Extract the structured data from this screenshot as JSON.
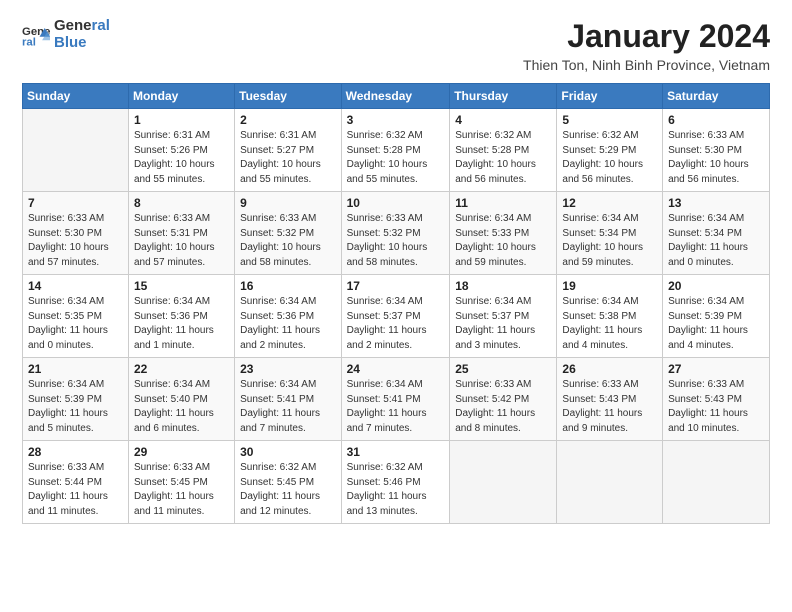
{
  "logo": {
    "text_general": "General",
    "text_blue": "Blue"
  },
  "title": "January 2024",
  "subtitle": "Thien Ton, Ninh Binh Province, Vietnam",
  "days_header": [
    "Sunday",
    "Monday",
    "Tuesday",
    "Wednesday",
    "Thursday",
    "Friday",
    "Saturday"
  ],
  "weeks": [
    [
      {
        "day": "",
        "info": ""
      },
      {
        "day": "1",
        "info": "Sunrise: 6:31 AM\nSunset: 5:26 PM\nDaylight: 10 hours\nand 55 minutes."
      },
      {
        "day": "2",
        "info": "Sunrise: 6:31 AM\nSunset: 5:27 PM\nDaylight: 10 hours\nand 55 minutes."
      },
      {
        "day": "3",
        "info": "Sunrise: 6:32 AM\nSunset: 5:28 PM\nDaylight: 10 hours\nand 55 minutes."
      },
      {
        "day": "4",
        "info": "Sunrise: 6:32 AM\nSunset: 5:28 PM\nDaylight: 10 hours\nand 56 minutes."
      },
      {
        "day": "5",
        "info": "Sunrise: 6:32 AM\nSunset: 5:29 PM\nDaylight: 10 hours\nand 56 minutes."
      },
      {
        "day": "6",
        "info": "Sunrise: 6:33 AM\nSunset: 5:30 PM\nDaylight: 10 hours\nand 56 minutes."
      }
    ],
    [
      {
        "day": "7",
        "info": "Sunrise: 6:33 AM\nSunset: 5:30 PM\nDaylight: 10 hours\nand 57 minutes."
      },
      {
        "day": "8",
        "info": "Sunrise: 6:33 AM\nSunset: 5:31 PM\nDaylight: 10 hours\nand 57 minutes."
      },
      {
        "day": "9",
        "info": "Sunrise: 6:33 AM\nSunset: 5:32 PM\nDaylight: 10 hours\nand 58 minutes."
      },
      {
        "day": "10",
        "info": "Sunrise: 6:33 AM\nSunset: 5:32 PM\nDaylight: 10 hours\nand 58 minutes."
      },
      {
        "day": "11",
        "info": "Sunrise: 6:34 AM\nSunset: 5:33 PM\nDaylight: 10 hours\nand 59 minutes."
      },
      {
        "day": "12",
        "info": "Sunrise: 6:34 AM\nSunset: 5:34 PM\nDaylight: 10 hours\nand 59 minutes."
      },
      {
        "day": "13",
        "info": "Sunrise: 6:34 AM\nSunset: 5:34 PM\nDaylight: 11 hours\nand 0 minutes."
      }
    ],
    [
      {
        "day": "14",
        "info": "Sunrise: 6:34 AM\nSunset: 5:35 PM\nDaylight: 11 hours\nand 0 minutes."
      },
      {
        "day": "15",
        "info": "Sunrise: 6:34 AM\nSunset: 5:36 PM\nDaylight: 11 hours\nand 1 minute."
      },
      {
        "day": "16",
        "info": "Sunrise: 6:34 AM\nSunset: 5:36 PM\nDaylight: 11 hours\nand 2 minutes."
      },
      {
        "day": "17",
        "info": "Sunrise: 6:34 AM\nSunset: 5:37 PM\nDaylight: 11 hours\nand 2 minutes."
      },
      {
        "day": "18",
        "info": "Sunrise: 6:34 AM\nSunset: 5:37 PM\nDaylight: 11 hours\nand 3 minutes."
      },
      {
        "day": "19",
        "info": "Sunrise: 6:34 AM\nSunset: 5:38 PM\nDaylight: 11 hours\nand 4 minutes."
      },
      {
        "day": "20",
        "info": "Sunrise: 6:34 AM\nSunset: 5:39 PM\nDaylight: 11 hours\nand 4 minutes."
      }
    ],
    [
      {
        "day": "21",
        "info": "Sunrise: 6:34 AM\nSunset: 5:39 PM\nDaylight: 11 hours\nand 5 minutes."
      },
      {
        "day": "22",
        "info": "Sunrise: 6:34 AM\nSunset: 5:40 PM\nDaylight: 11 hours\nand 6 minutes."
      },
      {
        "day": "23",
        "info": "Sunrise: 6:34 AM\nSunset: 5:41 PM\nDaylight: 11 hours\nand 7 minutes."
      },
      {
        "day": "24",
        "info": "Sunrise: 6:34 AM\nSunset: 5:41 PM\nDaylight: 11 hours\nand 7 minutes."
      },
      {
        "day": "25",
        "info": "Sunrise: 6:33 AM\nSunset: 5:42 PM\nDaylight: 11 hours\nand 8 minutes."
      },
      {
        "day": "26",
        "info": "Sunrise: 6:33 AM\nSunset: 5:43 PM\nDaylight: 11 hours\nand 9 minutes."
      },
      {
        "day": "27",
        "info": "Sunrise: 6:33 AM\nSunset: 5:43 PM\nDaylight: 11 hours\nand 10 minutes."
      }
    ],
    [
      {
        "day": "28",
        "info": "Sunrise: 6:33 AM\nSunset: 5:44 PM\nDaylight: 11 hours\nand 11 minutes."
      },
      {
        "day": "29",
        "info": "Sunrise: 6:33 AM\nSunset: 5:45 PM\nDaylight: 11 hours\nand 11 minutes."
      },
      {
        "day": "30",
        "info": "Sunrise: 6:32 AM\nSunset: 5:45 PM\nDaylight: 11 hours\nand 12 minutes."
      },
      {
        "day": "31",
        "info": "Sunrise: 6:32 AM\nSunset: 5:46 PM\nDaylight: 11 hours\nand 13 minutes."
      },
      {
        "day": "",
        "info": ""
      },
      {
        "day": "",
        "info": ""
      },
      {
        "day": "",
        "info": ""
      }
    ]
  ]
}
